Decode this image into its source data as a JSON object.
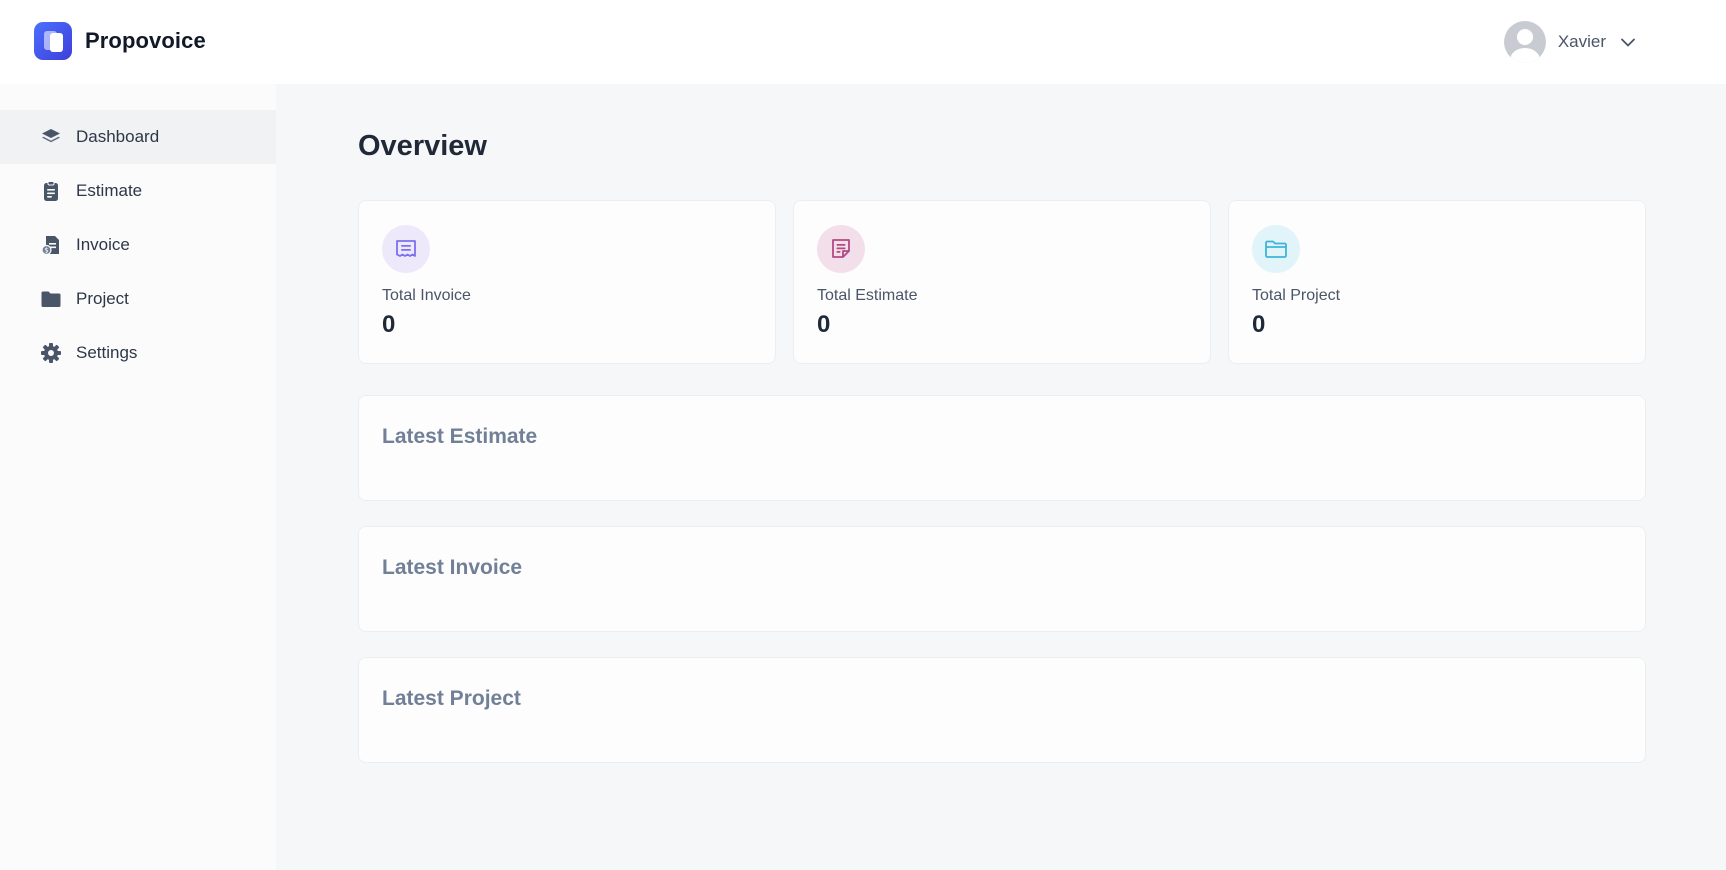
{
  "app": {
    "name": "Propovoice",
    "brand_color": "#4c6fff"
  },
  "user": {
    "name": "Xavier"
  },
  "sidebar": {
    "items": [
      {
        "label": "Dashboard",
        "icon": "dashboard-icon",
        "active": true
      },
      {
        "label": "Estimate",
        "icon": "clipboard-icon",
        "active": false
      },
      {
        "label": "Invoice",
        "icon": "invoice-icon",
        "active": false
      },
      {
        "label": "Project",
        "icon": "folder-icon",
        "active": false
      },
      {
        "label": "Settings",
        "icon": "gear-icon",
        "active": false
      }
    ]
  },
  "main": {
    "title": "Overview",
    "stats": [
      {
        "label": "Total Invoice",
        "value": "0",
        "icon": "receipt-icon",
        "color": "#7c6ff0",
        "bg": "#ede9fb"
      },
      {
        "label": "Total Estimate",
        "value": "0",
        "icon": "note-icon",
        "color": "#b24a86",
        "bg": "#f3dfe9"
      },
      {
        "label": "Total Project",
        "value": "0",
        "icon": "folder-icon",
        "color": "#3fb4d8",
        "bg": "#e1f4fa"
      }
    ],
    "sections": [
      {
        "title": "Latest Estimate"
      },
      {
        "title": "Latest Invoice"
      },
      {
        "title": "Latest Project"
      }
    ]
  }
}
